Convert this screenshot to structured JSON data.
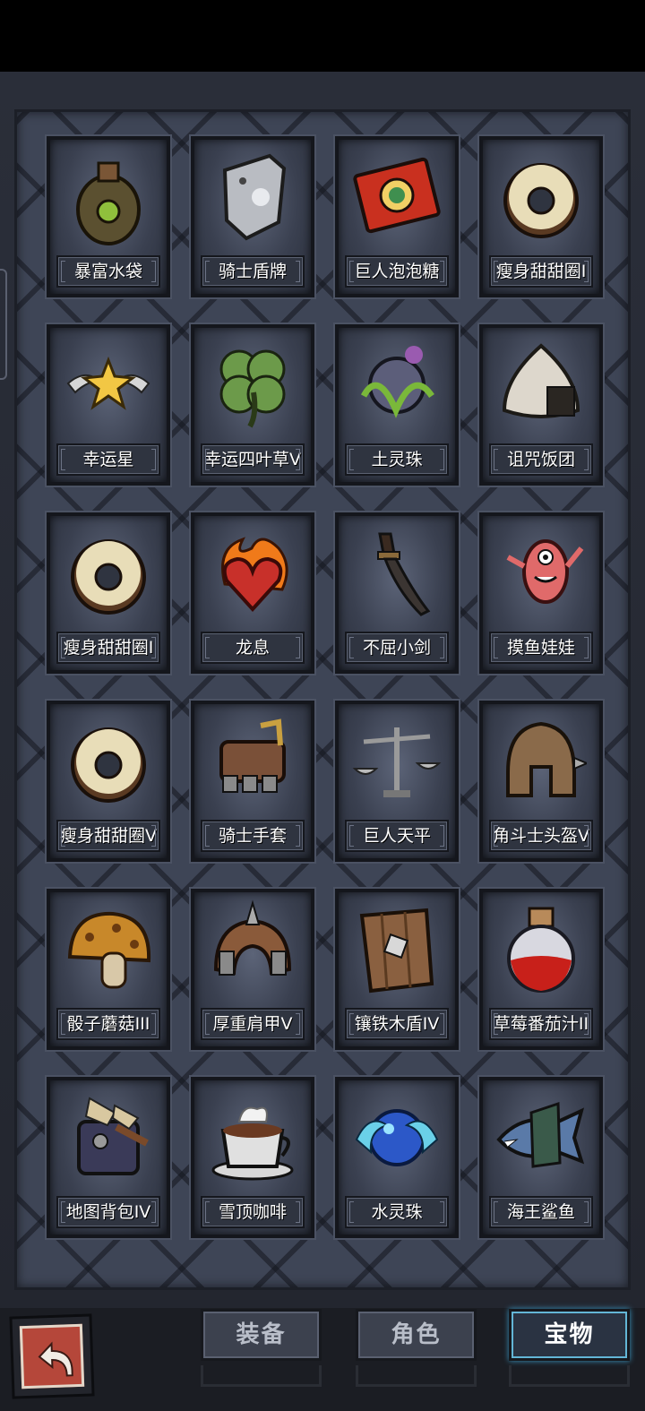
{
  "items": [
    {
      "label": "暴富水袋",
      "icon": "pouch-icon"
    },
    {
      "label": "骑士盾牌",
      "icon": "knight-shield-icon"
    },
    {
      "label": "巨人泡泡糖",
      "icon": "gum-pack-icon"
    },
    {
      "label": "瘦身甜甜圈I",
      "icon": "donut-icon"
    },
    {
      "label": "幸运星",
      "icon": "winged-star-icon"
    },
    {
      "label": "幸运四叶草V",
      "icon": "clover-icon"
    },
    {
      "label": "土灵珠",
      "icon": "earth-orb-icon"
    },
    {
      "label": "诅咒饭团",
      "icon": "rice-ball-icon"
    },
    {
      "label": "瘦身甜甜圈I",
      "icon": "donut-icon"
    },
    {
      "label": "龙息",
      "icon": "flaming-heart-icon"
    },
    {
      "label": "不屈小剑",
      "icon": "short-sword-icon"
    },
    {
      "label": "摸鱼娃娃",
      "icon": "pink-doll-icon"
    },
    {
      "label": "瘦身甜甜圈V",
      "icon": "donut-icon"
    },
    {
      "label": "骑士手套",
      "icon": "gauntlet-icon"
    },
    {
      "label": "巨人天平",
      "icon": "scales-icon"
    },
    {
      "label": "角斗士头盔V",
      "icon": "gladiator-helmet-icon"
    },
    {
      "label": "骰子蘑菇III",
      "icon": "mushroom-icon"
    },
    {
      "label": "厚重肩甲V",
      "icon": "pauldron-icon"
    },
    {
      "label": "镶铁木盾IV",
      "icon": "wooden-shield-icon"
    },
    {
      "label": "草莓番茄汁II",
      "icon": "red-potion-icon"
    },
    {
      "label": "地图背包IV",
      "icon": "map-backpack-icon"
    },
    {
      "label": "雪顶咖啡",
      "icon": "coffee-cup-icon"
    },
    {
      "label": "水灵珠",
      "icon": "water-orb-icon"
    },
    {
      "label": "海王鲨鱼",
      "icon": "shark-icon"
    }
  ],
  "tabs": [
    {
      "label": "装备",
      "active": false
    },
    {
      "label": "角色",
      "active": false
    },
    {
      "label": "宝物",
      "active": true
    }
  ],
  "back_button": {
    "icon": "back-arrow-icon"
  },
  "colors": {
    "panel": "#3e4556",
    "active_tab_glow": "#63b6d6",
    "back_button": "#b5473a"
  }
}
